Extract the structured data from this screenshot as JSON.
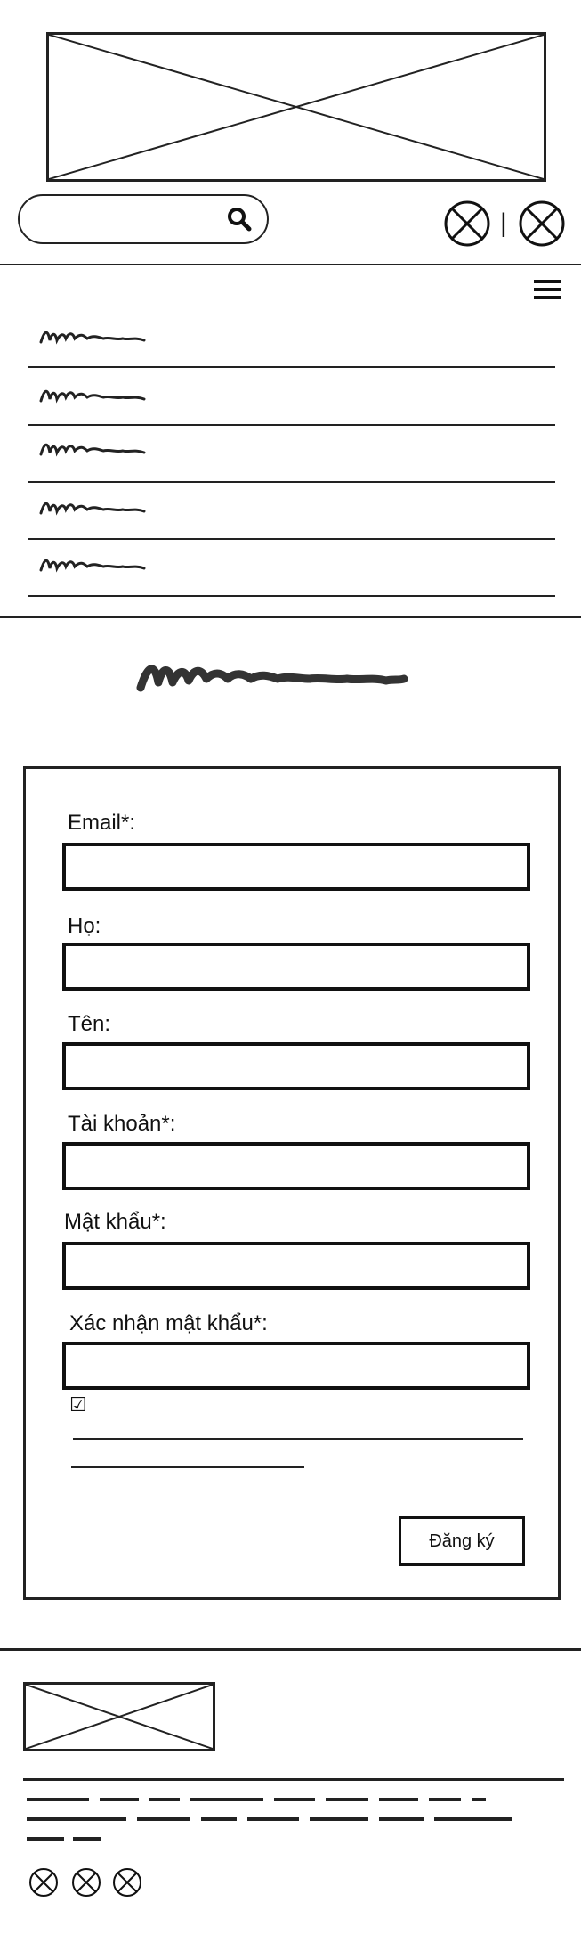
{
  "header": {
    "logo": "placeholder-image",
    "search": {
      "placeholder": "",
      "icon": "search-icon"
    },
    "actions": [
      {
        "icon": "x-circle-icon"
      },
      {
        "icon": "x-circle-icon"
      }
    ],
    "separator": "|"
  },
  "nav": {
    "menu_icon": "hamburger-icon",
    "items": [
      "scribble",
      "scribble",
      "scribble",
      "scribble",
      "scribble"
    ]
  },
  "page_title": "scribble",
  "form": {
    "fields": [
      {
        "label": "Email*:",
        "value": ""
      },
      {
        "label": "Họ:",
        "value": ""
      },
      {
        "label": "Tên:",
        "value": ""
      },
      {
        "label": "Tài khoản*:",
        "value": ""
      },
      {
        "label": "Mật khẩu*:",
        "value": ""
      },
      {
        "label": "Xác nhận mật khẩu*:",
        "value": ""
      }
    ],
    "checkbox_checked": true,
    "checkbox_glyph": "☑",
    "submit_label": "Đăng ký"
  },
  "footer": {
    "logo": "placeholder-image",
    "social_icons": [
      "x-circle-icon",
      "x-circle-icon",
      "x-circle-icon"
    ]
  }
}
